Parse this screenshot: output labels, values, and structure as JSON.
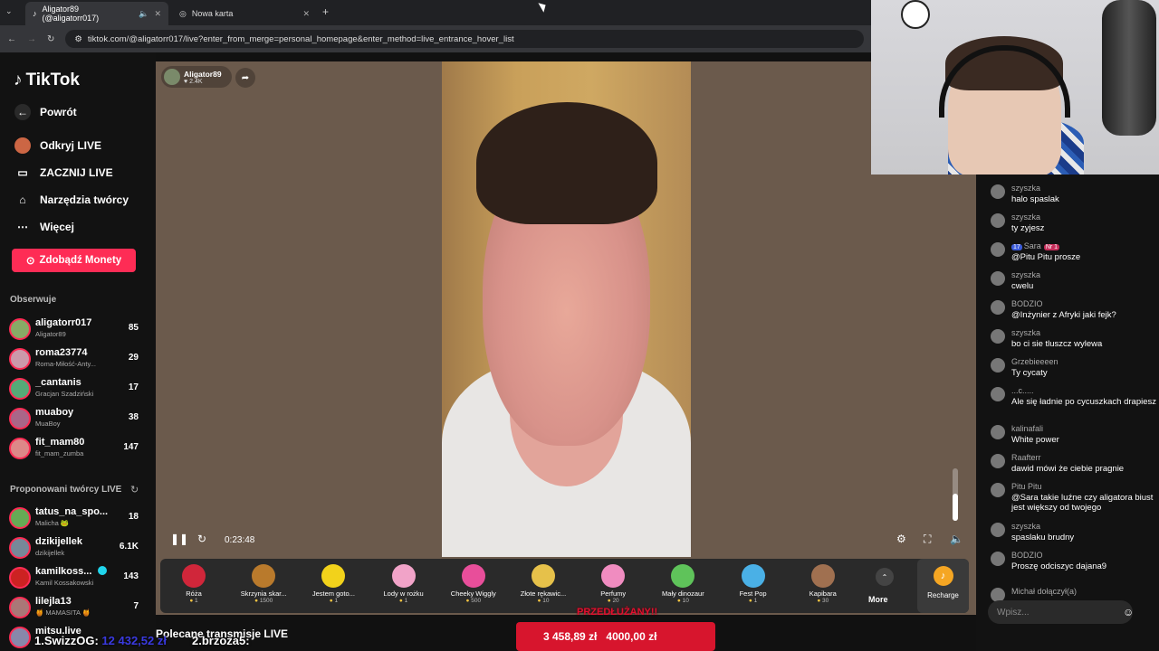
{
  "browser": {
    "tabs": [
      {
        "title": "Aligator89 (@aligatorr017)"
      },
      {
        "title": "Nowa karta"
      }
    ],
    "url": "tiktok.com/@aligatorr017/live?enter_from_merge=personal_homepage&enter_method=live_entrance_hover_list"
  },
  "sidebar": {
    "logo": "TikTok",
    "nav": [
      "Powrót",
      "Odkryj LIVE",
      "ZACZNIJ LIVE",
      "Narzędzia twórcy",
      "Więcej"
    ],
    "coins_button": "Zdobądź Monety",
    "follow_heading": "Obserwuje",
    "following": [
      {
        "name": "aligatorr017",
        "sub": "Aligator89",
        "count": "85"
      },
      {
        "name": "roma23774",
        "sub": "Roma-Miłość-Anty...",
        "count": "29"
      },
      {
        "name": "_cantanis",
        "sub": "Gracjan Szadziński",
        "count": "17"
      },
      {
        "name": "muaboy",
        "sub": "MuaBoy",
        "count": "38"
      },
      {
        "name": "fit_mam80",
        "sub": "fit_mam_zumba",
        "count": "147"
      }
    ],
    "suggest_heading": "Proponowani twórcy LIVE",
    "suggested": [
      {
        "name": "tatus_na_spo...",
        "sub": "Malicha 🐸",
        "count": "18"
      },
      {
        "name": "dzikijellek",
        "sub": "dzikijellek",
        "count": "6.1K"
      },
      {
        "name": "kamilkoss...",
        "sub": "Kamil Kossakowski",
        "count": "143"
      },
      {
        "name": "lilejla13",
        "sub": "🍯 MAMASITA 🍯",
        "count": "7"
      },
      {
        "name": "mitsu.live",
        "sub": "",
        "count": ""
      }
    ]
  },
  "live": {
    "streamer": "Aligator89",
    "likes": "2.4K",
    "time": "0:23:48",
    "gifts": [
      {
        "name": "Róża",
        "price": "1",
        "color": "#d0263a"
      },
      {
        "name": "Skrzynia skar...",
        "price": "1500",
        "color": "#b97a2c"
      },
      {
        "name": "Jestem goto...",
        "price": "1",
        "color": "#f2d21b"
      },
      {
        "name": "Lody w rożku",
        "price": "1",
        "color": "#f1a3c8"
      },
      {
        "name": "Cheeky Wiggly",
        "price": "500",
        "color": "#e84e9a"
      },
      {
        "name": "Złote rękawic...",
        "price": "10",
        "color": "#e6c14a"
      },
      {
        "name": "Perfumy",
        "price": "20",
        "color": "#f08cc0"
      },
      {
        "name": "Mały dinozaur",
        "price": "10",
        "color": "#5fc35a"
      },
      {
        "name": "Fest Pop",
        "price": "1",
        "color": "#4ab0e6"
      },
      {
        "name": "Kapibara",
        "price": "30",
        "color": "#a07050"
      }
    ],
    "more_label": "More",
    "recharge_label": "Recharge"
  },
  "bottom": {
    "title": "Polecane transmisje LIVE",
    "overlay_rank1": "1.SwizzOG:",
    "overlay_amount1": "12 432,52 zł",
    "overlay_rank2": "2.brzoza5:",
    "promo": "PRZEDŁUŻANY!!",
    "progress_current": "3 458,89 zł",
    "progress_goal": "4000,00 zł",
    "progress_value": 0.86
  },
  "chat": {
    "messages": [
      {
        "user": "szyszka",
        "text": "halo spaslak"
      },
      {
        "user": "szyszka",
        "text": "ty zyjesz"
      },
      {
        "user": "Sara",
        "badge1": "17",
        "badge2": "Nr 1",
        "text": "@Pitu Pitu prosze"
      },
      {
        "user": "szyszka",
        "text": "cwelu"
      },
      {
        "user": "BODZIO",
        "text": "@Inżynier z Afryki jaki fejk?"
      },
      {
        "user": "szyszka",
        "text": "bo ci sie tluszcz wylewa"
      },
      {
        "user": "Grzebieeeen",
        "text": "Ty cycaty"
      },
      {
        "user": "...c.....",
        "text": "Ale się ładnie po cycuszkach drapiesz"
      },
      {
        "user": "kalinafali",
        "text": "White power"
      },
      {
        "user": "Raafterr",
        "text": "dawid mówi że ciebie pragnie"
      },
      {
        "user": "Pitu Pitu",
        "text": "@Sara takie luźne czy aligatora biust jest większy od twojego"
      },
      {
        "user": "szyszka",
        "text": "spaslaku brudny"
      },
      {
        "user": "BODZIO",
        "text": "Proszę odciszyc dajana9"
      },
      {
        "user": "Michał dołączył(a)",
        "text": ""
      }
    ],
    "input_placeholder": "Wpisz..."
  }
}
